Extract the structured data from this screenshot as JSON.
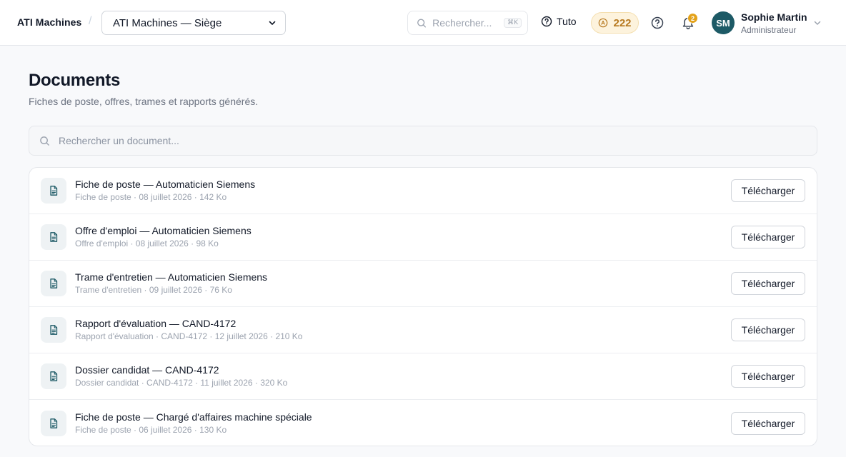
{
  "app": {
    "brand": "ATI Machines",
    "breadcrumb_separator": "/",
    "org_select": {
      "selected": "ATI Machines — Siège"
    },
    "search": {
      "placeholder": "Rechercher...",
      "shortcut": "⌘K"
    },
    "tuto_label": "Tuto",
    "credits": "222",
    "notifications_count": "2",
    "user": {
      "initials": "SM",
      "name": "Sophie Martin",
      "role": "Administrateur"
    }
  },
  "page": {
    "title": "Documents",
    "subtitle": "Fiches de poste, offres, trames et rapports générés.",
    "search_placeholder": "Rechercher un document..."
  },
  "documents": [
    {
      "title": "Fiche de poste — Automaticien Siemens",
      "meta": "Fiche de poste · 08 juillet 2026 · 142 Ko",
      "action": "Télécharger"
    },
    {
      "title": "Offre d'emploi — Automaticien Siemens",
      "meta": "Offre d'emploi · 08 juillet 2026 · 98 Ko",
      "action": "Télécharger"
    },
    {
      "title": "Trame d'entretien — Automaticien Siemens",
      "meta": "Trame d'entretien · 09 juillet 2026 · 76 Ko",
      "action": "Télécharger"
    },
    {
      "title": "Rapport d'évaluation — CAND-4172",
      "meta": "Rapport d'évaluation · CAND-4172 · 12 juillet 2026 · 210 Ko",
      "action": "Télécharger"
    },
    {
      "title": "Dossier candidat — CAND-4172",
      "meta": "Dossier candidat · CAND-4172 · 11 juillet 2026 · 320 Ko",
      "action": "Télécharger"
    },
    {
      "title": "Fiche de poste — Chargé d'affaires machine spéciale",
      "meta": "Fiche de poste · 06 juillet 2026 · 130 Ko",
      "action": "Télécharger"
    }
  ],
  "colors": {
    "accent": "#1d5a66",
    "credits_text": "#b7791f",
    "credits_bg": "#fdf3dd",
    "badge": "#e3a21a"
  },
  "icons": {
    "search": "search-icon",
    "chevron": "chevron-down-icon",
    "help": "help-circle-icon",
    "coin": "coin-icon",
    "bell": "bell-icon",
    "document": "document-icon"
  }
}
